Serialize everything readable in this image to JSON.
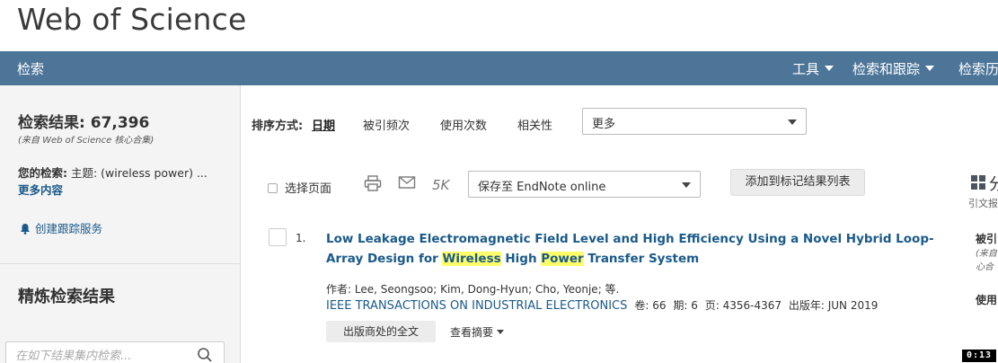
{
  "app": {
    "title": "Web of Science"
  },
  "nav": {
    "search": "检索",
    "tools": "工具",
    "search_and_track": "检索和跟踪",
    "search_history": "检索历"
  },
  "sidebar": {
    "results_label": "检索结果:",
    "results_count": "67,396",
    "source_note": "(来自 Web of Science 核心合集)",
    "your_search_label": "您的检索:",
    "your_search_value": "主题: (wireless power) ...",
    "more_link": "更多内容",
    "create_alert": "创建跟踪服务",
    "refine_title": "精炼检索结果",
    "refine_placeholder": "在如下结果集内检索..."
  },
  "sort": {
    "label": "排序方式:",
    "options": [
      "日期",
      "被引频次",
      "使用次数",
      "相关性"
    ],
    "active": "日期",
    "more_select": "更多"
  },
  "toolbar": {
    "select_page": "选择页面",
    "fivek": "5K",
    "save_to": "保存至 EndNote online",
    "add_marked": "添加到标记结果列表",
    "analyze": "分",
    "cite_label": "引文报"
  },
  "records": [
    {
      "num": "1.",
      "title_parts": [
        {
          "text": "Low Leakage Electromagnetic Field Level and High Efficiency Using a Novel Hybrid Loop-Array Design for ",
          "hl": false
        },
        {
          "text": "Wireless",
          "hl": true
        },
        {
          "text": " High ",
          "hl": false
        },
        {
          "text": "Power",
          "hl": true
        },
        {
          "text": " Transfer System",
          "hl": false
        }
      ],
      "authors_label": "作者:",
      "authors": "Lee, Seongsoo; Kim, Dong-Hyun; Cho, Yeonje; 等.",
      "journal": "IEEE TRANSACTIONS ON INDUSTRIAL ELECTRONICS",
      "volume_label": "卷:",
      "volume": "66",
      "issue_label": "期:",
      "issue": "6",
      "pages_label": "页:",
      "pages": "4356-4367",
      "pubyear_label": "出版年:",
      "pubyear": "JUN 2019",
      "fulltext_button": "出版商处的全文",
      "abstract_link": "查看摘要",
      "right_a": "被引",
      "right_b1": "(来自",
      "right_b2": "心合",
      "right_c": "使用"
    }
  ],
  "timer": "0:13",
  "colors": {
    "navbar": "#4d7598",
    "link": "#1a5a8a",
    "highlight": "#fffe68"
  }
}
